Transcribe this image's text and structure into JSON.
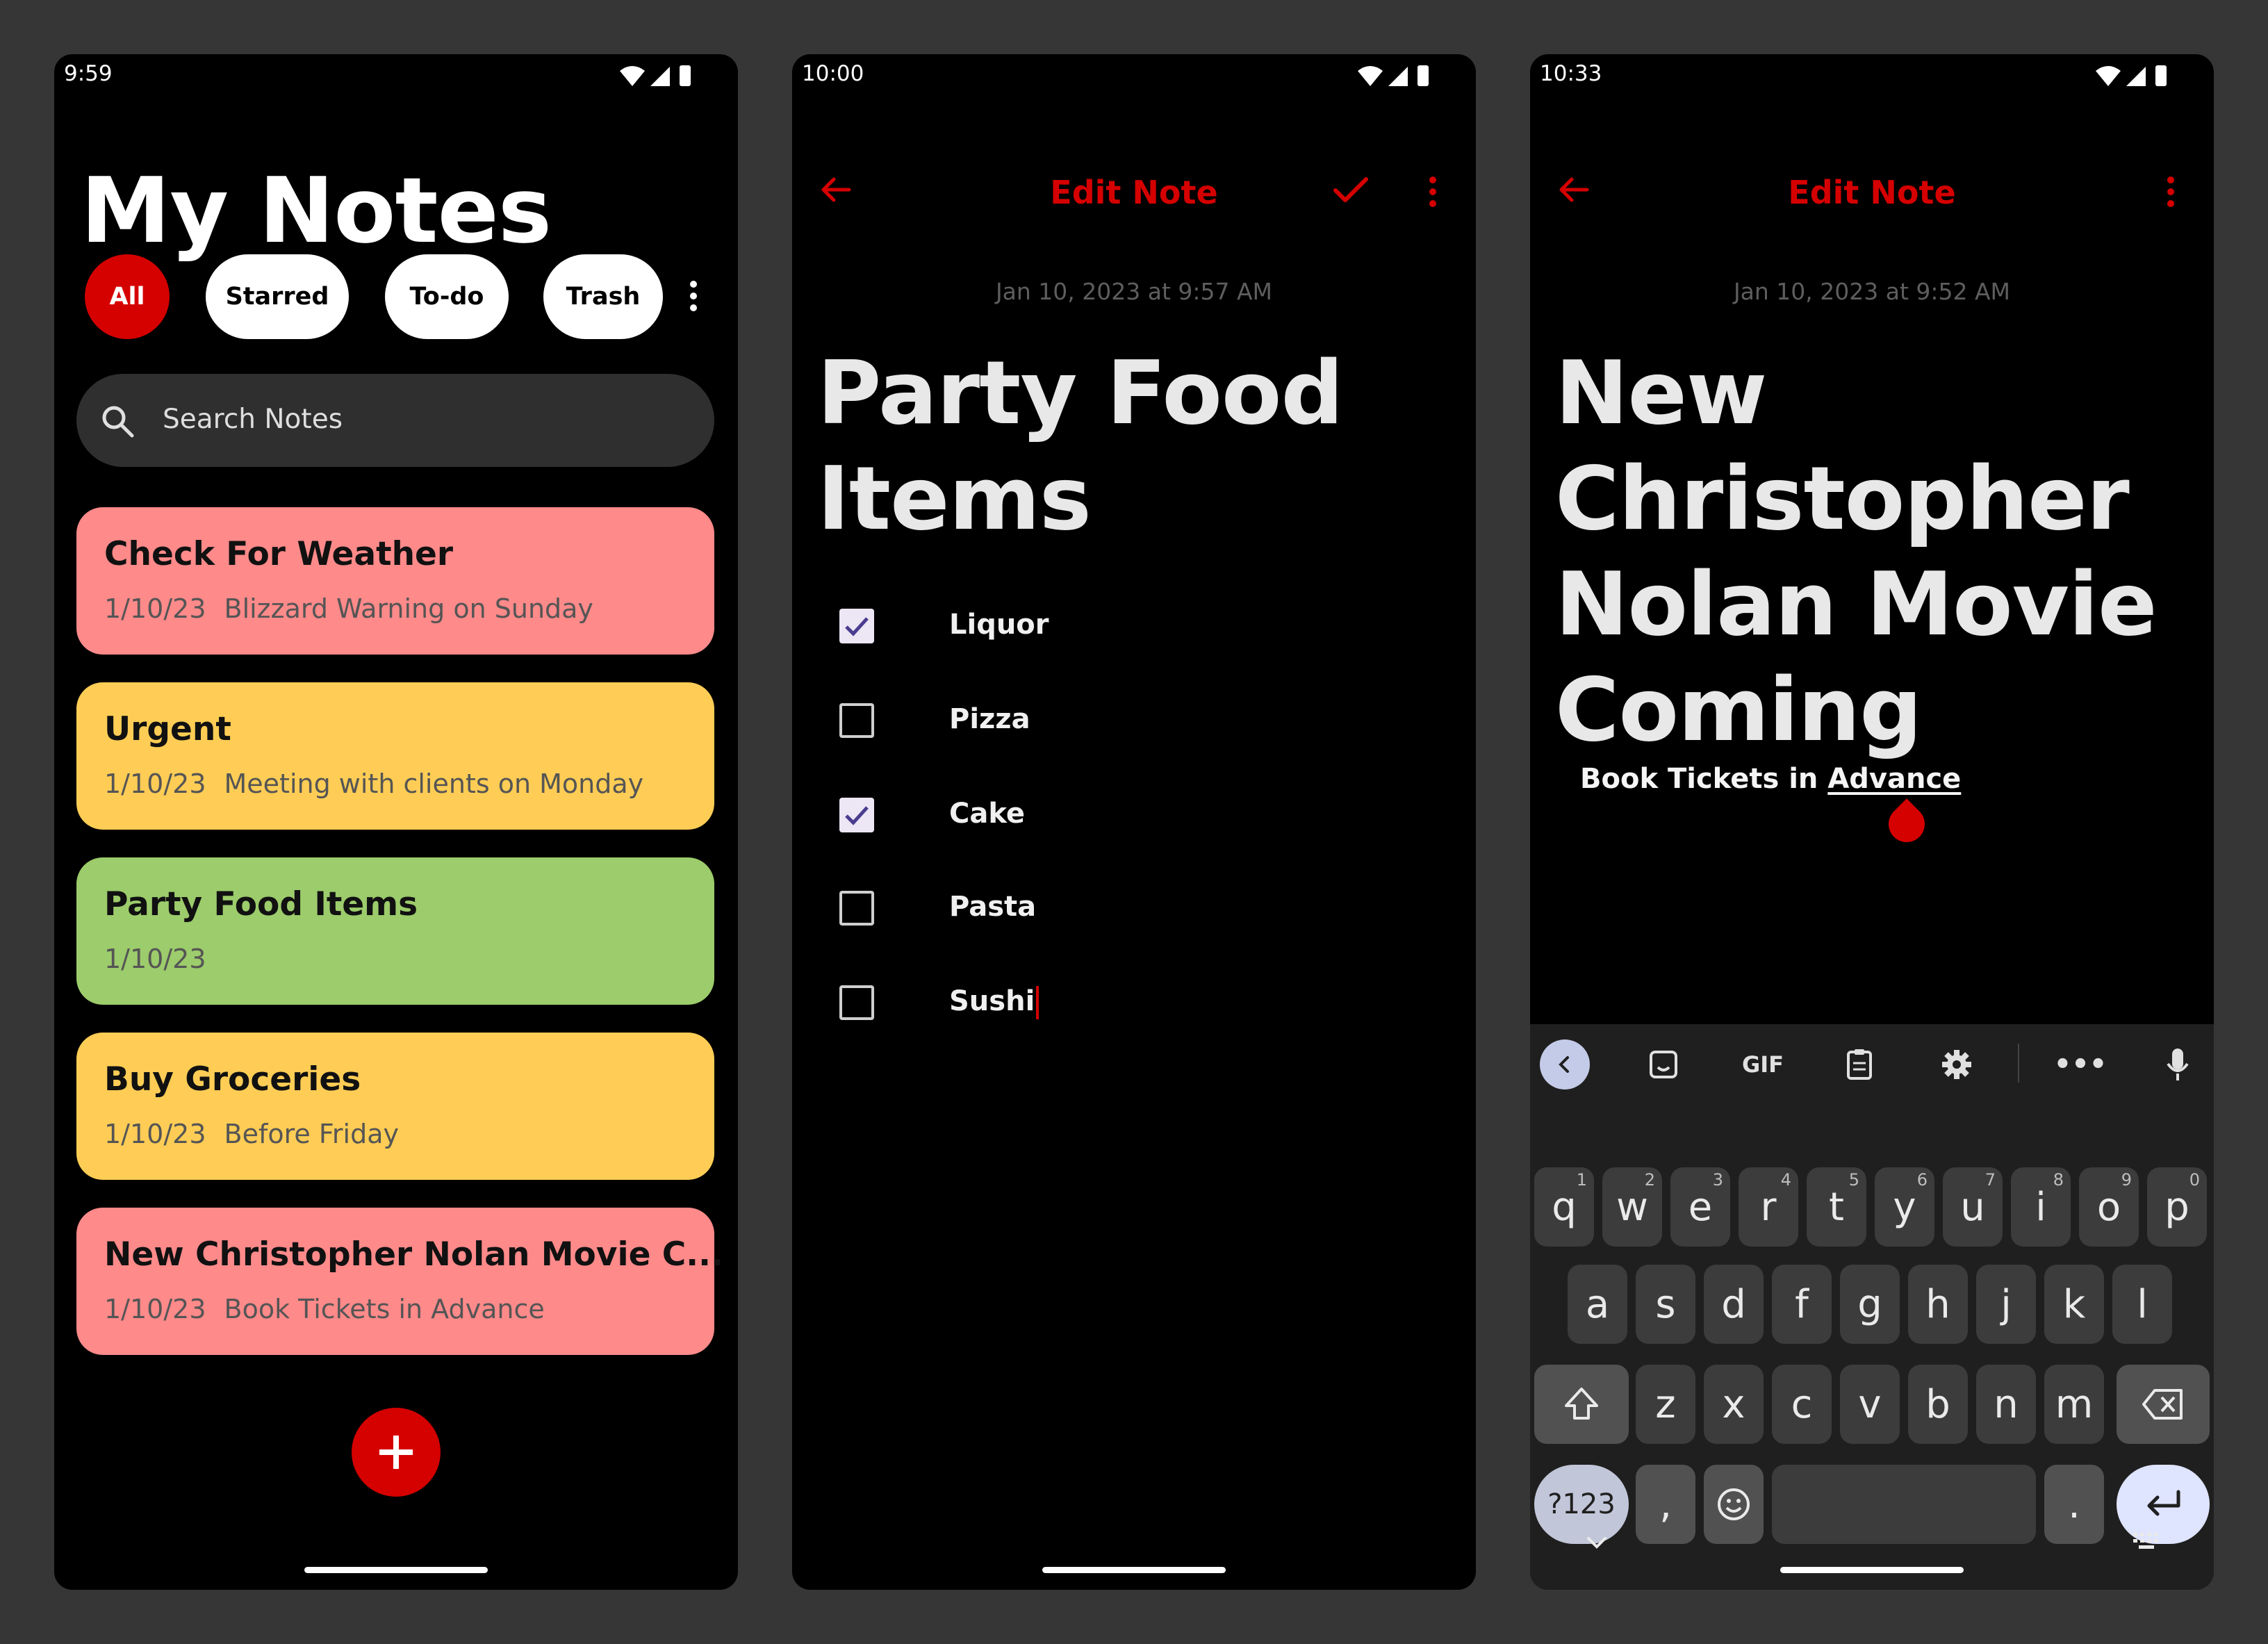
{
  "colors": {
    "accent": "#d50000",
    "note_red": "#ff8a8a",
    "note_yellow": "#ffcd55",
    "note_green": "#9ccc6b",
    "background": "#363636"
  },
  "screen1": {
    "time": "9:59",
    "title": "My Notes",
    "chips": [
      "All",
      "Starred",
      "To-do",
      "Trash"
    ],
    "search_placeholder": "Search Notes",
    "notes": [
      {
        "title": "Check For Weather",
        "date": "1/10/23",
        "preview": "Blizzard Warning on Sunday",
        "color": "#ff8a8a"
      },
      {
        "title": "Urgent",
        "date": "1/10/23",
        "preview": "Meeting with clients on Monday",
        "color": "#ffcd55"
      },
      {
        "title": "Party Food Items",
        "date": "1/10/23",
        "preview": "",
        "color": "#9ccc6b"
      },
      {
        "title": "Buy Groceries",
        "date": "1/10/23",
        "preview": "Before Friday",
        "color": "#ffcd55"
      },
      {
        "title": "New Christopher Nolan Movie C...",
        "date": "1/10/23",
        "preview": "Book Tickets in Advance",
        "color": "#ff8a8a"
      }
    ]
  },
  "screen2": {
    "time": "10:00",
    "header": "Edit Note",
    "date": "Jan 10, 2023 at 9:57 AM",
    "title_lines": [
      "Party Food",
      "Items"
    ],
    "items": [
      {
        "label": "Liquor",
        "checked": true
      },
      {
        "label": "Pizza",
        "checked": false
      },
      {
        "label": "Cake",
        "checked": true
      },
      {
        "label": "Pasta",
        "checked": false
      },
      {
        "label": "Sushi",
        "checked": false
      }
    ]
  },
  "screen3": {
    "time": "10:33",
    "header": "Edit Note",
    "date": "Jan 10, 2023 at 9:52 AM",
    "title_lines": [
      "New",
      "Christopher",
      "Nolan Movie",
      "Coming"
    ],
    "body_prefix": "Book Tickets in ",
    "body_link": "Advance",
    "keyboard": {
      "gif": "GIF",
      "row1": [
        "q",
        "w",
        "e",
        "r",
        "t",
        "y",
        "u",
        "i",
        "o",
        "p"
      ],
      "row1_hints": [
        "1",
        "2",
        "3",
        "4",
        "5",
        "6",
        "7",
        "8",
        "9",
        "0"
      ],
      "row2": [
        "a",
        "s",
        "d",
        "f",
        "g",
        "h",
        "j",
        "k",
        "l"
      ],
      "row3": [
        "z",
        "x",
        "c",
        "v",
        "b",
        "n",
        "m"
      ],
      "symbols": "?123",
      "comma": ",",
      "period": "."
    }
  }
}
